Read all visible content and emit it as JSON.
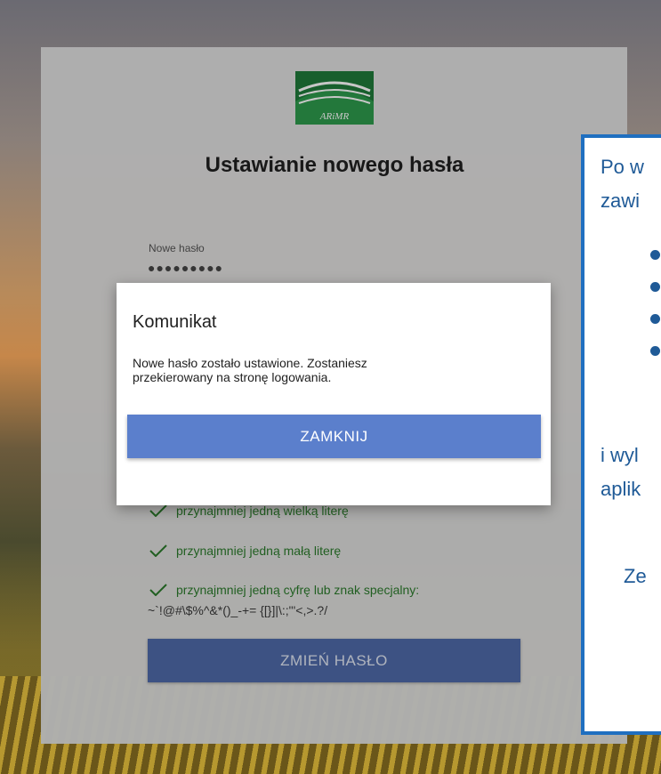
{
  "card": {
    "title": "Ustawianie nowego hasła",
    "new_password_label": "Nowe hasło",
    "new_password_value": "●●●●●●●●●",
    "logo_text": "ARiMR"
  },
  "rules": [
    {
      "text": "przynajmniej jedną wielką literę"
    },
    {
      "text": "przynajmniej jedną małą literę"
    },
    {
      "text": "przynajmniej jedną cyfrę lub znak specjalny:"
    }
  ],
  "rules_special_chars": "~`!@#\\$%^&*()_-+= {[}]|\\:;\"'<,>.?/",
  "change_button_label": "ZMIEŃ HASŁO",
  "dialog": {
    "title": "Komunikat",
    "message": "Nowe hasło zostało ustawione. Zostaniesz przekierowany na stronę logowania.",
    "close_button_label": "ZAMKNIJ"
  },
  "callout": {
    "line1": "Po w",
    "line2": "zawi",
    "line3": "i wyl",
    "line4": "aplik",
    "line5": "Ze"
  },
  "colors": {
    "accent_blue": "#5b7fcc",
    "success_green": "#2b7a2b",
    "callout_border": "#1f6fc0"
  }
}
